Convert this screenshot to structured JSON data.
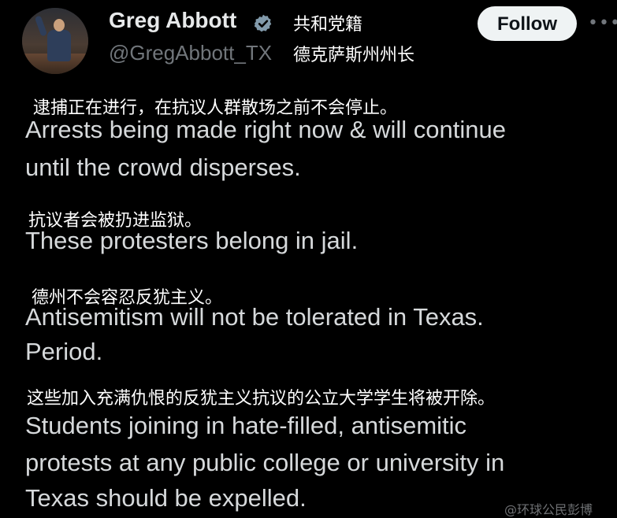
{
  "author": {
    "name": "Greg Abbott",
    "name_annotation": "共和党籍",
    "handle": "@GregAbbott_TX",
    "handle_annotation": "德克萨斯州州长",
    "verified": true
  },
  "follow_label": "Follow",
  "more_icon": "ellipsis-icon",
  "paragraphs": [
    {
      "translation": "逮捕正在进行，在抗议人群散场之前不会停止。",
      "lines": [
        "Arrests being made right now & will continue",
        "until the crowd disperses."
      ]
    },
    {
      "translation": "抗议者会被扔进监狱。",
      "lines": [
        "These protesters belong in jail."
      ]
    },
    {
      "translation": "德州不会容忍反犹主义。",
      "lines": [
        "Antisemitism will not be tolerated in Texas.",
        "Period."
      ]
    },
    {
      "translation": "这些加入充满仇恨的反犹主义抗议的公立大学学生将被开除。",
      "lines": [
        "Students joining in hate-filled, antisemitic",
        "protests at any public college or university in",
        "Texas should be expelled."
      ]
    }
  ],
  "watermark": "@环球公民彭博",
  "colors": {
    "background": "#000000",
    "verified_badge": "#829aab",
    "handle_gray": "#71767b",
    "follow_bg": "#eff3f4"
  }
}
